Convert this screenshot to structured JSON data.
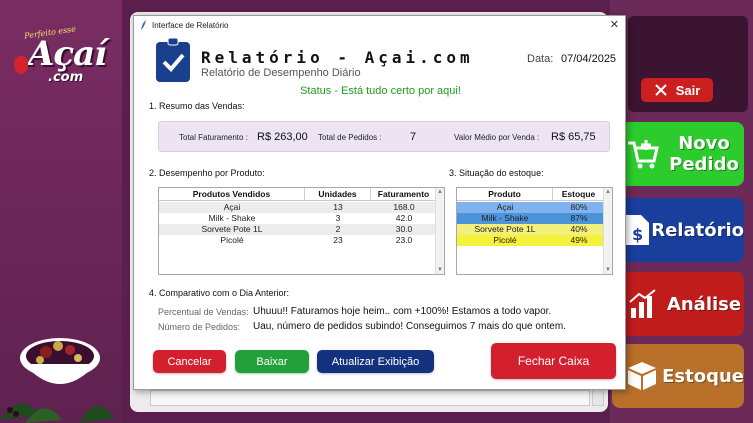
{
  "brand": {
    "tagline": "Perfeito esse",
    "name": "Açaí",
    "suffix": ".com"
  },
  "sidebar": {
    "sair_label": "Sair",
    "buttons": [
      {
        "label": "Novo Pedido",
        "icon": "cart-icon"
      },
      {
        "label": "Relatório",
        "icon": "document-dollar-icon"
      },
      {
        "label": "Análise",
        "icon": "bar-chart-icon"
      },
      {
        "label": "Estoque",
        "icon": "boxes-icon"
      }
    ]
  },
  "dialog": {
    "window_title": "Interface de Relatório",
    "title": "Relatório - Açai.com",
    "subtitle": "Relatório de Desempenho Diário",
    "date_label": "Data:",
    "date_value": "07/04/2025",
    "status": "Status - Está tudo certo por aqui!",
    "sections": {
      "resumo": "1. Resumo das Vendas:",
      "desempenho": "2. Desempenho por Produto:",
      "estoque": "3. Situação do estoque:",
      "comparativo": "4. Comparativo com o Dia Anterior:"
    },
    "summary": {
      "faturamento_label": "Total Faturamento :",
      "faturamento_value": "R$ 263,00",
      "pedidos_label": "Total de Pedidos :",
      "pedidos_value": "7",
      "medio_label": "Valor Médio por Venda :",
      "medio_value": "R$ 65,75"
    },
    "product_table": {
      "headers": [
        "Produtos Vendidos",
        "Unidades",
        "Faturamento"
      ],
      "rows": [
        [
          "Açai",
          "13",
          "168.0"
        ],
        [
          "Milk - Shake",
          "3",
          "42.0"
        ],
        [
          "Sorvete Pote 1L",
          "2",
          "30.0"
        ],
        [
          "Picolé",
          "23",
          "23.0"
        ]
      ]
    },
    "stock_table": {
      "headers": [
        "Produto",
        "Estoque"
      ],
      "rows": [
        {
          "produto": "Açai",
          "estoque": "80%",
          "color": "#7fb2ee"
        },
        {
          "produto": "Milk - Shake",
          "estoque": "87%",
          "color": "#4d93d9"
        },
        {
          "produto": "Sorvete Pote 1L",
          "estoque": "40%",
          "color": "#f2ef7a"
        },
        {
          "produto": "Picolé",
          "estoque": "49%",
          "color": "#f6f13a"
        }
      ]
    },
    "comparison": {
      "vendas_label": "Percentual de Vendas:",
      "vendas_value": "Uhuuu!! Faturamos hoje heim.. com +100%! Estamos a todo vapor.",
      "pedidos_label": "Número de Pedidos:",
      "pedidos_value": "Uau, número de pedidos subindo! Conseguimos 7 mais do que ontem."
    },
    "buttons": {
      "cancel": "Cancelar",
      "download": "Baixar",
      "refresh": "Atualizar Exibição",
      "close_register": "Fechar Caixa"
    }
  }
}
